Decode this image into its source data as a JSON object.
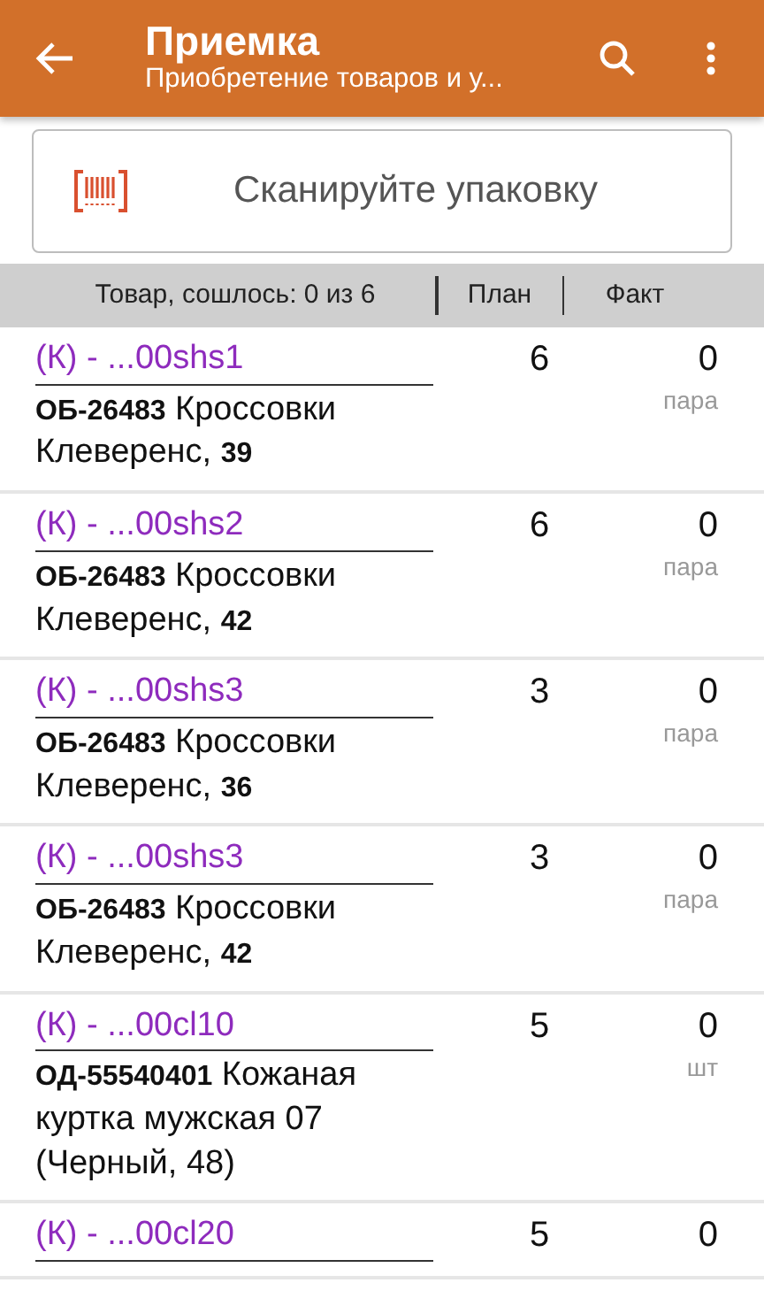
{
  "app_bar": {
    "title": "Приемка",
    "subtitle": "Приобретение товаров и у..."
  },
  "scan_field": {
    "placeholder": "Сканируйте упаковку"
  },
  "table": {
    "columns": [
      "Товар, сошлось: 0 из 6",
      "План",
      "Факт"
    ],
    "rows": [
      {
        "code": "(К) - ...00shs1",
        "description": "**ОБ-26483** Кроссовки Клеверенс, **39**",
        "plan": "6",
        "fact": "0",
        "unit": "пара"
      },
      {
        "code": "(К) - ...00shs2",
        "description": "**ОБ-26483** Кроссовки Клеверенс, **42**",
        "plan": "6",
        "fact": "0",
        "unit": "пара"
      },
      {
        "code": "(К) - ...00shs3",
        "description": "**ОБ-26483** Кроссовки Клеверенс, **36**",
        "plan": "3",
        "fact": "0",
        "unit": "пара"
      },
      {
        "code": "(К) - ...00shs3",
        "description": "**ОБ-26483** Кроссовки Клеверенс, **42**",
        "plan": "3",
        "fact": "0",
        "unit": "пара"
      },
      {
        "code": "(К) - ...00cl10",
        "description": "**ОД-55540401** Кожаная куртка мужская 07 (Черный, 48)",
        "plan": "5",
        "fact": "0",
        "unit": "шт"
      },
      {
        "code": "(К) - ...00cl20",
        "plan": "5",
        "fact": "0"
      }
    ]
  }
}
